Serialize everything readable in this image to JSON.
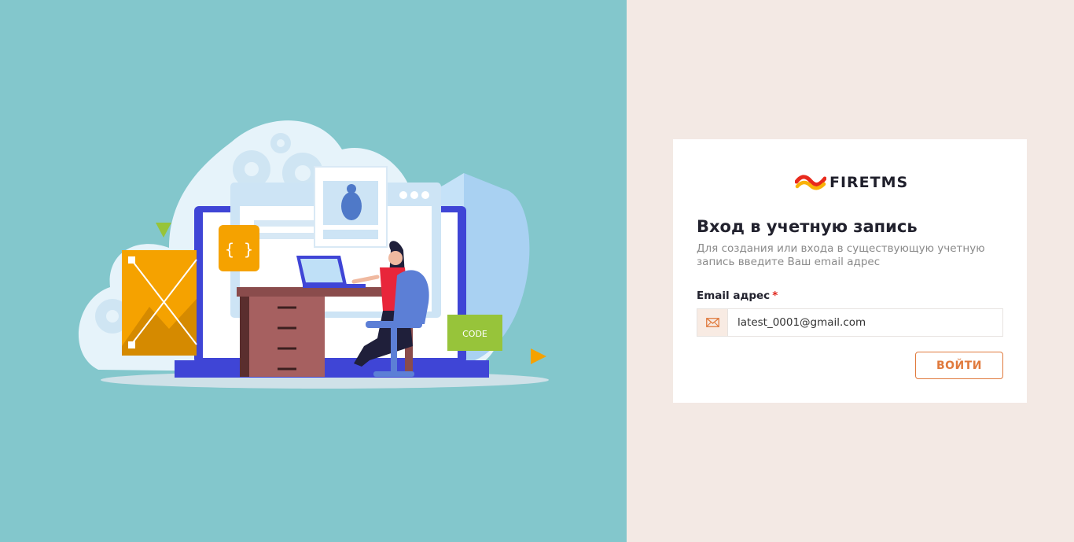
{
  "brand": {
    "name": "FIRETMS"
  },
  "login": {
    "title": "Вход в учетную запись",
    "subtitle": "Для создания или входа в существующую учетную запись введите Ваш email адрес",
    "email_label": "Email адрес",
    "required_mark": "*",
    "email_value": "latest_0001@gmail.com",
    "submit_label": "ВОЙТИ"
  },
  "illustration": {
    "code_badge": "CODE",
    "braces_badge": "{ }"
  },
  "colors": {
    "left_bg": "#83c7cc",
    "right_bg": "#f3e9e4",
    "accent": "#e07a3d",
    "required": "#e0241b"
  }
}
